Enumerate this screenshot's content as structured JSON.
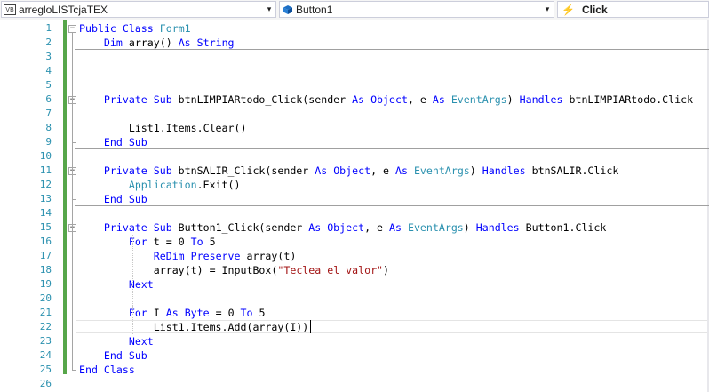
{
  "navbar": {
    "project": {
      "label": "arregloLISTcjaTEX",
      "icon": "vb-project-icon",
      "badge": "VB"
    },
    "object": {
      "label": "Button1",
      "icon": "class-cube-icon"
    },
    "event": {
      "label": "Click",
      "icon": "event-bolt-icon"
    },
    "dropdown_glyph": "▾"
  },
  "editor": {
    "line_numbers": [
      "1",
      "2",
      "3",
      "4",
      "5",
      "6",
      "7",
      "8",
      "9",
      "10",
      "11",
      "12",
      "13",
      "14",
      "15",
      "16",
      "17",
      "18",
      "19",
      "20",
      "21",
      "22",
      "23",
      "24",
      "25",
      "26"
    ],
    "collapse_glyph": "−",
    "lines": [
      [
        {
          "t": "Public Class ",
          "c": "kw"
        },
        {
          "t": "Form1",
          "c": "ty"
        }
      ],
      [
        {
          "t": "    "
        },
        {
          "t": "Dim",
          "c": "kw"
        },
        {
          "t": " array() "
        },
        {
          "t": "As String",
          "c": "kw"
        }
      ],
      [],
      [],
      [],
      [
        {
          "t": "    "
        },
        {
          "t": "Private Sub",
          "c": "kw"
        },
        {
          "t": " btnLIMPIARtodo_Click(sender "
        },
        {
          "t": "As Object",
          "c": "kw"
        },
        {
          "t": ", e "
        },
        {
          "t": "As",
          "c": "kw"
        },
        {
          "t": " "
        },
        {
          "t": "EventArgs",
          "c": "ty"
        },
        {
          "t": ") "
        },
        {
          "t": "Handles",
          "c": "kw"
        },
        {
          "t": " btnLIMPIARtodo.Click"
        }
      ],
      [],
      [
        {
          "t": "        List1.Items.Clear()"
        }
      ],
      [
        {
          "t": "    "
        },
        {
          "t": "End Sub",
          "c": "kw"
        }
      ],
      [],
      [
        {
          "t": "    "
        },
        {
          "t": "Private Sub",
          "c": "kw"
        },
        {
          "t": " btnSALIR_Click(sender "
        },
        {
          "t": "As Object",
          "c": "kw"
        },
        {
          "t": ", e "
        },
        {
          "t": "As",
          "c": "kw"
        },
        {
          "t": " "
        },
        {
          "t": "EventArgs",
          "c": "ty"
        },
        {
          "t": ") "
        },
        {
          "t": "Handles",
          "c": "kw"
        },
        {
          "t": " btnSALIR.Click"
        }
      ],
      [
        {
          "t": "        "
        },
        {
          "t": "Application",
          "c": "ty"
        },
        {
          "t": ".Exit()"
        }
      ],
      [
        {
          "t": "    "
        },
        {
          "t": "End Sub",
          "c": "kw"
        }
      ],
      [],
      [
        {
          "t": "    "
        },
        {
          "t": "Private Sub",
          "c": "kw"
        },
        {
          "t": " Button1_Click(sender "
        },
        {
          "t": "As Object",
          "c": "kw"
        },
        {
          "t": ", e "
        },
        {
          "t": "As",
          "c": "kw"
        },
        {
          "t": " "
        },
        {
          "t": "EventArgs",
          "c": "ty"
        },
        {
          "t": ") "
        },
        {
          "t": "Handles",
          "c": "kw"
        },
        {
          "t": " Button1.Click"
        }
      ],
      [
        {
          "t": "        "
        },
        {
          "t": "For",
          "c": "kw"
        },
        {
          "t": " t = 0 "
        },
        {
          "t": "To",
          "c": "kw"
        },
        {
          "t": " 5"
        }
      ],
      [
        {
          "t": "            "
        },
        {
          "t": "ReDim Preserve",
          "c": "kw"
        },
        {
          "t": " array(t)"
        }
      ],
      [
        {
          "t": "            array(t) = InputBox("
        },
        {
          "t": "\"Teclea el valor\"",
          "c": "str"
        },
        {
          "t": ")"
        }
      ],
      [
        {
          "t": "        "
        },
        {
          "t": "Next",
          "c": "kw"
        }
      ],
      [],
      [
        {
          "t": "        "
        },
        {
          "t": "For",
          "c": "kw"
        },
        {
          "t": " I "
        },
        {
          "t": "As Byte",
          "c": "kw"
        },
        {
          "t": " = 0 "
        },
        {
          "t": "To",
          "c": "kw"
        },
        {
          "t": " 5"
        }
      ],
      [
        {
          "t": "            List1.Items.Add(array(I))"
        }
      ],
      [
        {
          "t": "        "
        },
        {
          "t": "Next",
          "c": "kw"
        }
      ],
      [
        {
          "t": "    "
        },
        {
          "t": "End Sub",
          "c": "kw"
        }
      ],
      [
        {
          "t": "End Class",
          "c": "kw"
        }
      ],
      []
    ]
  }
}
